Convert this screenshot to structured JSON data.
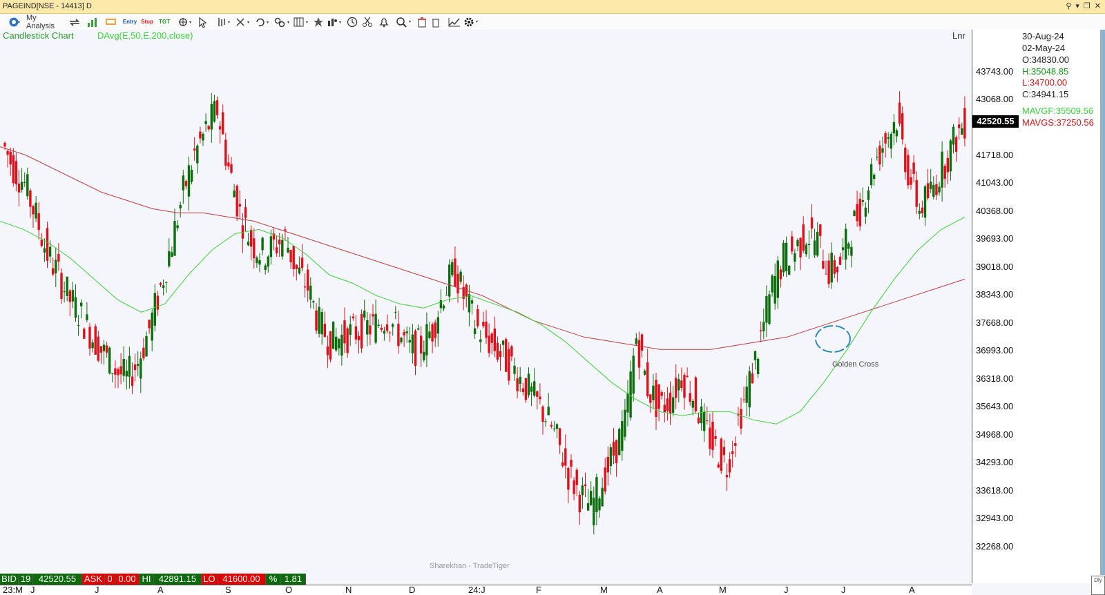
{
  "window": {
    "title": "PAGEIND[NSE - 14413] D"
  },
  "toolbar": {
    "my_analysis_label": "My Analysis",
    "entry_label": "Entry",
    "stop_label": "Stop",
    "tgt_label": "TGT"
  },
  "chart_header": {
    "chart_type": "Candlestick Chart",
    "indicator": "DAvg(E,50,E,200,close)",
    "scale_mode": "Lnr"
  },
  "y_axis": {
    "labels": [
      "43743.00",
      "43068.00",
      "41718.00",
      "41043.00",
      "40368.00",
      "39693.00",
      "39018.00",
      "38343.00",
      "37668.00",
      "36993.00",
      "36318.00",
      "35643.00",
      "34968.00",
      "34293.00",
      "33618.00",
      "32943.00",
      "32268.00"
    ]
  },
  "current_price": "42520.55",
  "info_panel": {
    "date1": "30-Aug-24",
    "date2": "02-May-24",
    "open": "O:34830.00",
    "high": "H:35048.85",
    "low": "L:34700.00",
    "close": "C:34941.15",
    "mavg_fast": "MAVGF:35509.56",
    "mavg_slow": "MAVGS:37250.56"
  },
  "annotation": {
    "label": "Golden Cross"
  },
  "watermark": "Sharekhan - TradeTiger",
  "quote_bar": {
    "bid_label": "BID",
    "bid_qty": "19",
    "bid_price": "42520.55",
    "ask_label": "ASK",
    "ask_qty": "0",
    "ask_price": "0.00",
    "hi_label": "HI",
    "hi_value": "42891.15",
    "lo_label": "LO",
    "lo_value": "41600.00",
    "pct_label": "%",
    "pct_value": "1.81"
  },
  "x_axis": {
    "labels": [
      "23:M",
      "J",
      "J",
      "A",
      "S",
      "O",
      "N",
      "D",
      "24:J",
      "F",
      "M",
      "A",
      "M",
      "J",
      "J",
      "A"
    ]
  },
  "corner_label": "Dly",
  "colors": {
    "up": "#0c6e0c",
    "down": "#e0101a",
    "ma_fast": "#3ccf3c",
    "ma_slow": "#c23a3a",
    "annotation": "#2a8ab3"
  },
  "chart_data": {
    "type": "candlestick",
    "series": [
      {
        "name": "MAVGF",
        "indicator": "EMA 50",
        "values_approx": [
          40100,
          39900,
          39600,
          39200,
          38700,
          38200,
          37900,
          38100,
          38800,
          39400,
          39800,
          39900,
          39700,
          39300,
          38800,
          38600,
          38300,
          38100,
          38000,
          38200,
          38300,
          38100,
          37900,
          37600,
          37200,
          36700,
          36200,
          35800,
          35500,
          35400,
          35500,
          35500,
          35300,
          35200,
          35500,
          36200,
          37000,
          37900,
          38700,
          39400,
          39900,
          40200
        ]
      },
      {
        "name": "MAVGS",
        "indicator": "EMA 200",
        "values_approx": [
          41900,
          41700,
          41400,
          41100,
          40800,
          40600,
          40400,
          40300,
          40300,
          40200,
          40100,
          39900,
          39700,
          39500,
          39300,
          39100,
          38900,
          38700,
          38500,
          38300,
          38000,
          37700,
          37500,
          37300,
          37200,
          37100,
          37000,
          37000,
          37000,
          37100,
          37200,
          37300,
          37500,
          37700,
          37900,
          38100,
          38300,
          38500,
          38700
        ]
      }
    ],
    "ohlc_selected": {
      "date": "02-May-24",
      "open": 34830.0,
      "high": 35048.85,
      "low": 34700.0,
      "close": 34941.15
    },
    "last_close": 42520.55,
    "ylim": [
      32268,
      43743
    ],
    "yticks": [
      43743,
      43068,
      41718,
      41043,
      40368,
      39693,
      39018,
      38343,
      37668,
      36993,
      36318,
      35643,
      34968,
      34293,
      33618,
      32943,
      32268
    ],
    "closes_approx": [
      42000,
      41400,
      41000,
      40200,
      39300,
      38800,
      38200,
      37800,
      37300,
      36900,
      36500,
      36300,
      36700,
      37500,
      38500,
      39600,
      40800,
      41700,
      42300,
      42800,
      41400,
      40300,
      39600,
      39300,
      39500,
      39700,
      38900,
      38500,
      37600,
      37200,
      37300,
      37400,
      37500,
      37600,
      37800,
      37400,
      37000,
      37100,
      37500,
      38400,
      38900,
      38100,
      37500,
      37200,
      36900,
      36600,
      36200,
      35800,
      35400,
      34800,
      34000,
      33500,
      33200,
      33800,
      34500,
      35200,
      37300,
      36100,
      35600,
      35800,
      36400,
      35900,
      35100,
      34600,
      34200,
      35300,
      36200,
      37300,
      38500,
      39200,
      39400,
      39800,
      39600,
      38900,
      39100,
      39900,
      40600,
      41500,
      42100,
      42600,
      41300,
      40400,
      40800,
      41400,
      42000,
      42520
    ]
  }
}
